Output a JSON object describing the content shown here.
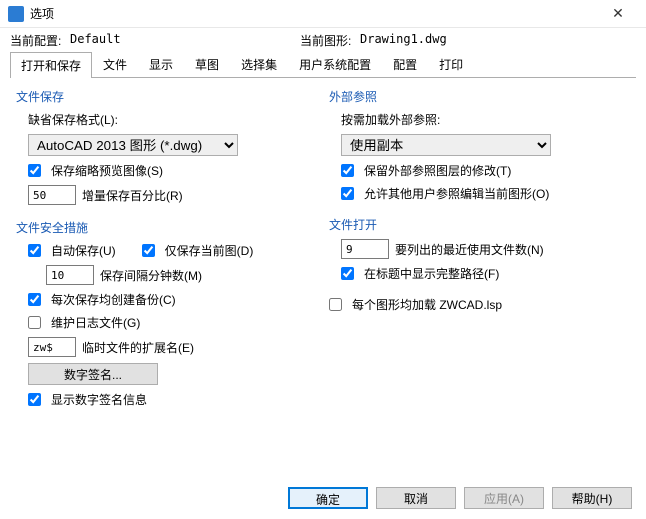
{
  "title": "选项",
  "close_glyph": "✕",
  "info": {
    "profile_label": "当前配置:",
    "profile_value": "Default",
    "drawing_label": "当前图形:",
    "drawing_value": "Drawing1.dwg"
  },
  "tabs": [
    "打开和保存",
    "文件",
    "显示",
    "草图",
    "选择集",
    "用户系统配置",
    "配置",
    "打印"
  ],
  "left": {
    "file_save_title": "文件保存",
    "default_format_label": "缺省保存格式(L):",
    "default_format_value": "AutoCAD 2013 图形 (*.dwg)",
    "save_thumb": "保存缩略预览图像(S)",
    "inc_save_value": "50",
    "inc_save_label": "增量保存百分比(R)",
    "safety_title": "文件安全措施",
    "autosave": "自动保存(U)",
    "only_current": "仅保存当前图(D)",
    "interval_value": "10",
    "interval_label": "保存间隔分钟数(M)",
    "create_backup": "每次保存均创建备份(C)",
    "maintain_log": "维护日志文件(G)",
    "temp_ext_value": "zw$",
    "temp_ext_label": "临时文件的扩展名(E)",
    "digital_sig_btn": "数字签名...",
    "show_sig": "显示数字签名信息"
  },
  "right": {
    "xref_title": "外部参照",
    "xref_load_label": "按需加载外部参照:",
    "xref_load_value": "使用副本",
    "keep_layer": "保留外部参照图层的修改(T)",
    "allow_edit": "允许其他用户参照编辑当前图形(O)",
    "open_title": "文件打开",
    "recent_value": "9",
    "recent_label": "要列出的最近使用文件数(N)",
    "fullpath": "在标题中显示完整路径(F)",
    "loadlsp": "每个图形均加载 ZWCAD.lsp"
  },
  "footer": {
    "ok": "确定",
    "cancel": "取消",
    "apply": "应用(A)",
    "help": "帮助(H)"
  }
}
